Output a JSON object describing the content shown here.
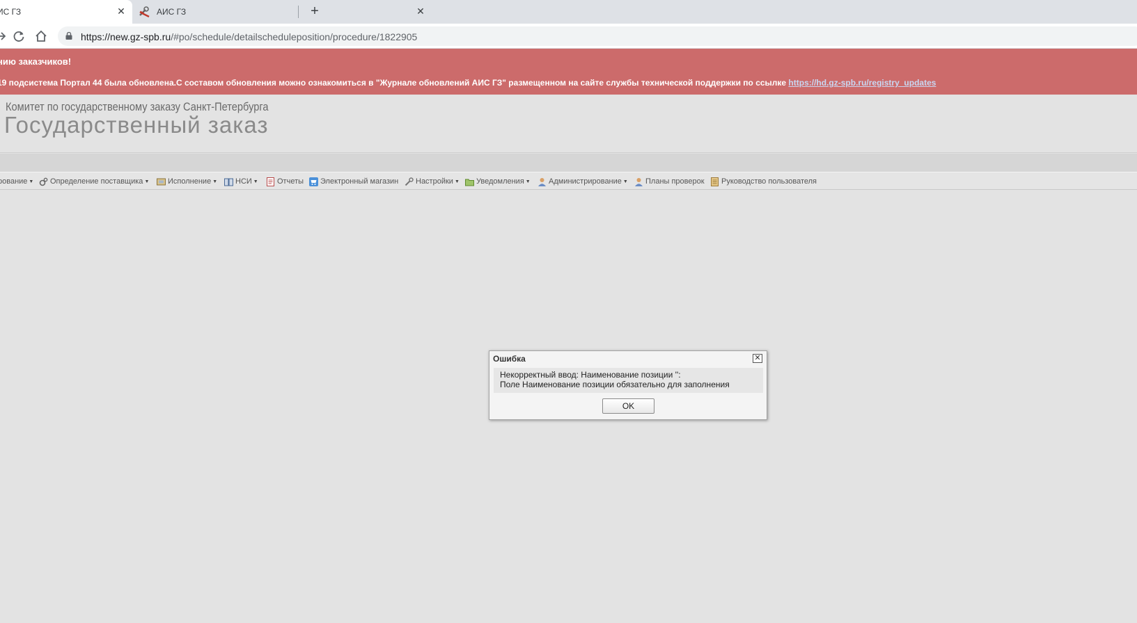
{
  "browser": {
    "tabs": [
      {
        "title": "ИС ГЗ",
        "close": "✕"
      },
      {
        "title": "АИС ГЗ",
        "close": "✕"
      }
    ],
    "new_tab": "+",
    "url_host": "https://new.gz-spb.ru",
    "url_path": "/#po/schedule/detailscheduleposition/procedure/1822905"
  },
  "notice": {
    "headline": "нию заказчиков!",
    "body": "19 подсистема Портал 44 была обновлена.С составом обновления можно ознакомиться в \"Журнале обновлений АИС ГЗ\" размещенном на сайте службы технической поддержки по ссылке ",
    "link": "https://hd.gz-spb.ru/registry_updates",
    "background": "#cc6b6b"
  },
  "header": {
    "subtitle": "Комитет по государственному заказу Санкт-Петербурга",
    "title": "Государственный заказ"
  },
  "menu": {
    "items": [
      {
        "label": "рование",
        "icon": "planning-icon"
      },
      {
        "label": "Определение поставщика",
        "icon": "gears-icon"
      },
      {
        "label": "Исполнение",
        "icon": "execution-icon"
      },
      {
        "label": "НСИ",
        "icon": "book-icon"
      },
      {
        "label": "Отчеты",
        "icon": "report-icon"
      },
      {
        "label": "Электронный магазин",
        "icon": "cart-icon"
      },
      {
        "label": "Настройки",
        "icon": "wrench-icon"
      },
      {
        "label": "Уведомления",
        "icon": "folder-icon"
      },
      {
        "label": "Администрирование",
        "icon": "user-icon"
      },
      {
        "label": "Планы проверок",
        "icon": "user-icon"
      },
      {
        "label": "Руководство пользователя",
        "icon": "manual-icon"
      }
    ]
  },
  "dialog": {
    "title": "Ошибка",
    "message_line1": "Некорректный ввод: Наименование позиции '':",
    "message_line2": "Поле Наименование позиции обязательно для заполнения",
    "ok_label": "OK",
    "close": "✕"
  }
}
